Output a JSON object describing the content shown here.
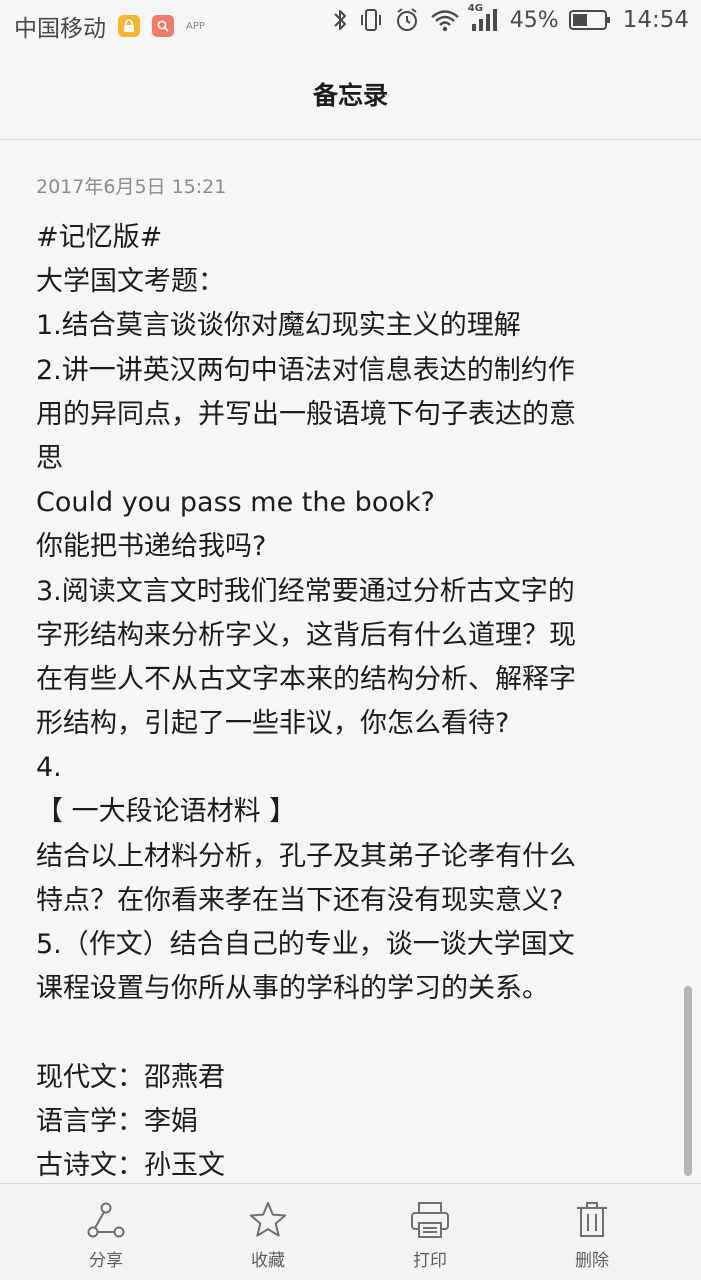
{
  "status_bar": {
    "carrier": "中国移动",
    "app_badge": "APP",
    "network": "4G",
    "battery_percent": "45%",
    "time": "14:54",
    "icons": [
      "lock-app-icon",
      "red-app-icon",
      "bluetooth-icon",
      "vibrate-icon",
      "alarm-icon",
      "wifi-icon",
      "signal-icon",
      "battery-icon"
    ]
  },
  "header": {
    "title": "备忘录"
  },
  "note": {
    "date": "2017年6月5日 15:21",
    "lines": [
      "#记忆版#",
      "大学国文考题：",
      "1.结合莫言谈谈你对魔幻现实主义的理解",
      "2.讲一讲英汉两句中语法对信息表达的制约作",
      "用的异同点，并写出一般语境下句子表达的意",
      "思",
      "Could you pass me the book?",
      "你能把书递给我吗?",
      "3.阅读文言文时我们经常要通过分析古文字的",
      "字形结构来分析字义，这背后有什么道理？现",
      "在有些人不从古文字本来的结构分析、解释字",
      "形结构，引起了一些非议，你怎么看待?",
      "4.",
      "【 一大段论语材料 】",
      "结合以上材料分析，孔子及其弟子论孝有什么",
      "特点？在你看来孝在当下还有没有现实意义?",
      "5.（作文）结合自己的专业，谈一谈大学国文",
      "课程设置与你所从事的学科的学习的关系。",
      "",
      "现代文：邵燕君",
      "语言学：李娟",
      "古诗文：孙玉文"
    ]
  },
  "toolbar": {
    "share_label": "分享",
    "favorite_label": "收藏",
    "print_label": "打印",
    "delete_label": "删除"
  },
  "colors": {
    "background": "#f6f6f6",
    "text": "#1c1c1c",
    "muted": "#8c8c8c",
    "icon": "#707070"
  }
}
